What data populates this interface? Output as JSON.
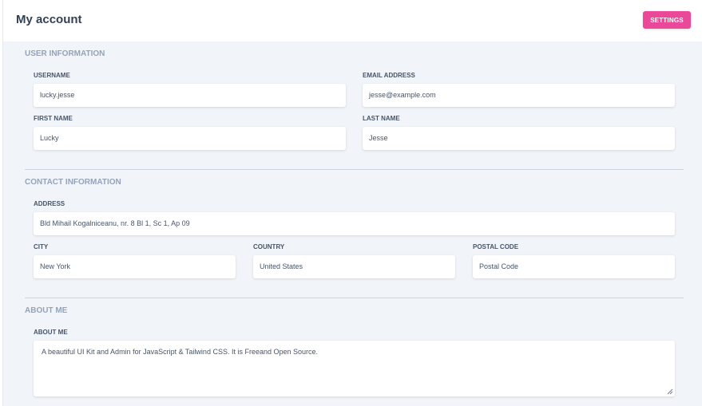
{
  "header": {
    "title": "My account",
    "settings_label": "SETTINGS"
  },
  "user_information": {
    "title": "USER INFORMATION",
    "username": {
      "label": "USERNAME",
      "value": "lucky.jesse"
    },
    "email": {
      "label": "EMAIL ADDRESS",
      "value": "jesse@example.com"
    },
    "first_name": {
      "label": "FIRST NAME",
      "value": "Lucky"
    },
    "last_name": {
      "label": "LAST NAME",
      "value": "Jesse"
    }
  },
  "contact_information": {
    "title": "CONTACT INFORMATION",
    "address": {
      "label": "ADDRESS",
      "value": "Bld Mihail Kogalniceanu, nr. 8 Bl 1, Sc 1, Ap 09"
    },
    "city": {
      "label": "CITY",
      "value": "New York"
    },
    "country": {
      "label": "COUNTRY",
      "value": "United States"
    },
    "postal_code": {
      "label": "POSTAL CODE",
      "value": "Postal Code"
    }
  },
  "about_me": {
    "title": "ABOUT ME",
    "label": "ABOUT ME",
    "value": "A beautiful UI Kit and Admin for JavaScript & Tailwind CSS. It is Freeand Open Source."
  },
  "colors": {
    "accent": "#ec4899",
    "background": "#f1f5f9",
    "section_title": "#94a3b8"
  }
}
